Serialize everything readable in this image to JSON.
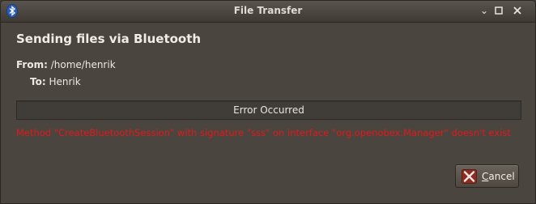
{
  "window": {
    "title": "File Transfer",
    "icons": {
      "app": "bluetooth-icon",
      "minimize": "minimize-icon",
      "maximize": "maximize-icon",
      "close": "close-icon"
    }
  },
  "dialog": {
    "heading": "Sending files via Bluetooth",
    "from_label": "From:",
    "from_value": "/home/henrik",
    "to_label": "To:",
    "to_value": "Henrik",
    "status": "Error Occurred",
    "error_message": "Method \"CreateBluetoothSession\" with signature \"sss\" on interface \"org.openobex.Manager\" doesn't exist",
    "cancel_label": "Cancel",
    "cancel_icon": "cancel-x-icon"
  },
  "colors": {
    "error": "#e0191b",
    "window_bg": "#4b453f",
    "text": "#ece9e2"
  }
}
